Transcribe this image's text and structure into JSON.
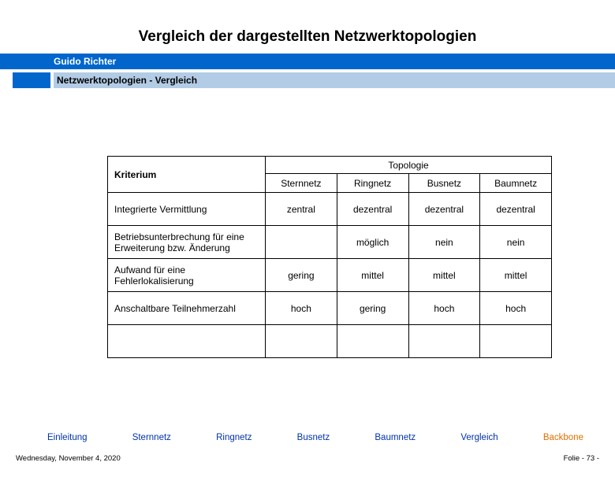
{
  "header": {
    "author": "Guido Richter",
    "breadcrumb": "Netzwerktopologien  - Vergleich"
  },
  "slide": {
    "title": "Vergleich der dargestellten Netzwerktopologien"
  },
  "table": {
    "kriterium_label": "Kriterium",
    "topologie_label": "Topologie",
    "cols": [
      "Sternnetz",
      "Ringnetz",
      "Busnetz",
      "Baumnetz"
    ],
    "rows": [
      {
        "k": "Integrierte Vermittlung",
        "v": [
          "zentral",
          "dezentral",
          "dezentral",
          "dezentral"
        ]
      },
      {
        "k": "Betriebsunterbrechung für eine Erweiterung bzw. Änderung",
        "v": [
          "",
          "möglich",
          "nein",
          "nein"
        ]
      },
      {
        "k": "Aufwand für eine Fehlerlokalisierung",
        "v": [
          "gering",
          "mittel",
          "mittel",
          "mittel"
        ]
      },
      {
        "k": "Anschaltbare Teilnehmerzahl",
        "v": [
          "hoch",
          "gering",
          "hoch",
          "hoch"
        ]
      }
    ]
  },
  "nav": {
    "items": [
      "Einleitung",
      "Sternnetz",
      "Ringnetz",
      "Busnetz",
      "Baumnetz",
      "Vergleich",
      "Backbone"
    ],
    "current_index": 6
  },
  "footer": {
    "date": "Wednesday, November 4, 2020",
    "page_prefix": "Folie - ",
    "page_num": "73",
    "page_suffix": " -"
  },
  "chart_data": {
    "type": "table",
    "title": "Vergleich der dargestellten Netzwerktopologien",
    "columns": [
      "Kriterium",
      "Sternnetz",
      "Ringnetz",
      "Busnetz",
      "Baumnetz"
    ],
    "rows": [
      [
        "Integrierte Vermittlung",
        "zentral",
        "dezentral",
        "dezentral",
        "dezentral"
      ],
      [
        "Betriebsunterbrechung für eine Erweiterung bzw. Änderung",
        "",
        "möglich",
        "nein",
        "nein"
      ],
      [
        "Aufwand für eine Fehlerlokalisierung",
        "gering",
        "mittel",
        "mittel",
        "mittel"
      ],
      [
        "Anschaltbare Teilnehmerzahl",
        "hoch",
        "gering",
        "hoch",
        "hoch"
      ]
    ]
  }
}
